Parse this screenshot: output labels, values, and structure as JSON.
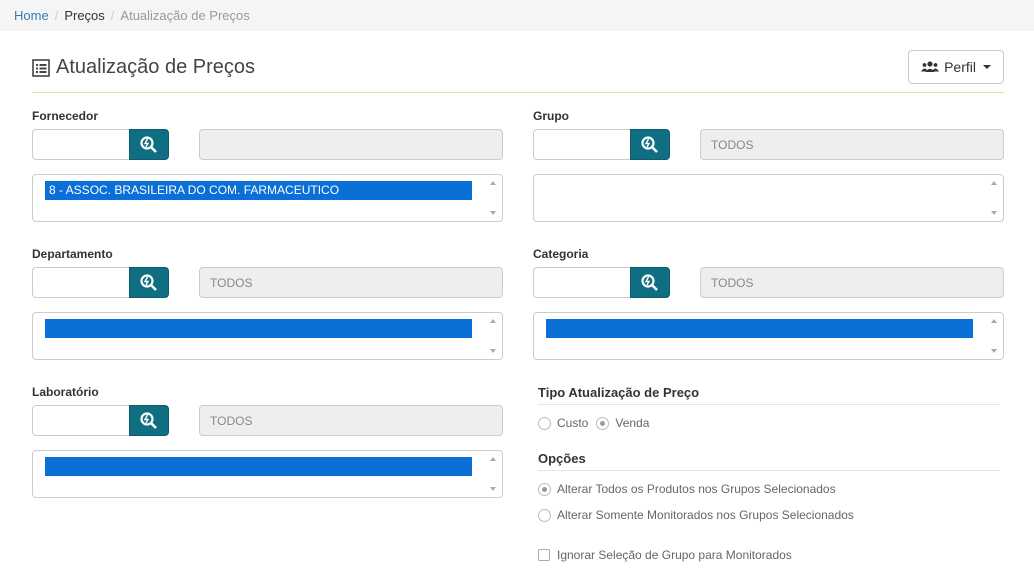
{
  "breadcrumb": {
    "home": "Home",
    "mid": "Preços",
    "current": "Atualização de Preços"
  },
  "header": {
    "title": "Atualização de Preços",
    "perfil_label": "Perfil"
  },
  "fields": {
    "fornecedor": {
      "label": "Fornecedor",
      "code": "",
      "description": "",
      "selected": "8 - ASSOC. BRASILEIRA DO COM. FARMACEUTICO"
    },
    "grupo": {
      "label": "Grupo",
      "code": "",
      "description": "TODOS",
      "selected": null
    },
    "departamento": {
      "label": "Departamento",
      "code": "",
      "description": "TODOS",
      "selected": ""
    },
    "categoria": {
      "label": "Categoria",
      "code": "",
      "description": "TODOS",
      "selected": ""
    },
    "laboratorio": {
      "label": "Laboratório",
      "code": "",
      "description": "TODOS",
      "selected": ""
    }
  },
  "tipo": {
    "title": "Tipo Atualização de Preço",
    "options": [
      {
        "label": "Custo",
        "checked": false
      },
      {
        "label": "Venda",
        "checked": true
      }
    ]
  },
  "opcoes": {
    "title": "Opções",
    "radios": [
      {
        "label": "Alterar Todos os Produtos nos Grupos Selecionados",
        "checked": true
      },
      {
        "label": "Alterar Somente Monitorados nos Grupos Selecionados",
        "checked": false
      }
    ],
    "checkbox": {
      "label": "Ignorar Seleção de Grupo para Monitorados",
      "checked": false
    }
  },
  "colors": {
    "accent": "#0f6e82",
    "selection": "#0a6fd6",
    "link": "#337ab7"
  }
}
